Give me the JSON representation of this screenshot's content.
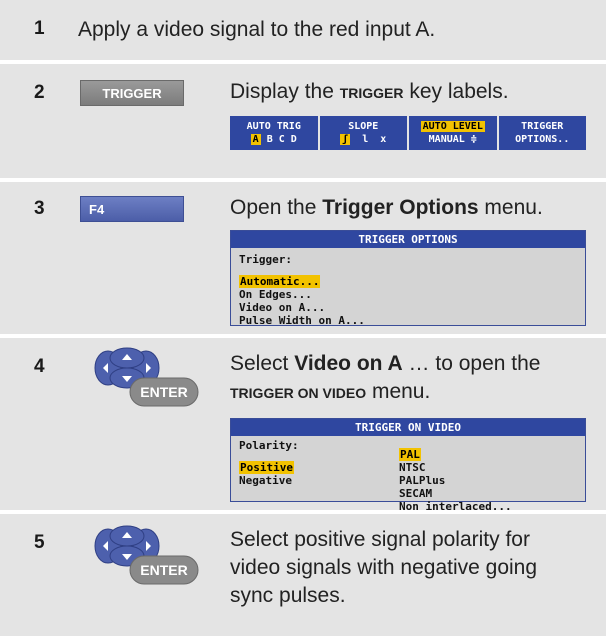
{
  "steps": [
    {
      "num": "1",
      "text": "Apply a video signal to the red input A."
    },
    {
      "num": "2",
      "text_before": "Display the ",
      "text_key": "TRIGGER",
      "text_after": " key labels.",
      "key": "TRIGGER"
    },
    {
      "num": "3",
      "text_before": "Open the ",
      "text_bold": "Trigger Options",
      "text_after": " menu.",
      "key": "F4"
    },
    {
      "num": "4",
      "text_before": "Select ",
      "text_bold": "Video on A",
      "text_middle": " … to open the ",
      "text_key": "TRIGGER ON VIDEO",
      "text_after": " menu.",
      "key": "ENTER"
    },
    {
      "num": "5",
      "line1": "Select positive signal polarity for",
      "line2": "video signals with negative going",
      "line3": "sync pulses.",
      "key": "ENTER"
    }
  ],
  "softkeys": [
    {
      "top": "AUTO TRIG",
      "bottom": "A B C D"
    },
    {
      "top": "SLOPE",
      "bottom": "ʃ  l  x"
    },
    {
      "top": "AUTO LEVEL",
      "bottom": "MANUAL ≑"
    },
    {
      "top": "TRIGGER",
      "bottom": "OPTIONS.."
    }
  ],
  "trigger_options_menu": {
    "title": "TRIGGER OPTIONS",
    "label": "Trigger:",
    "items": [
      "Automatic...",
      "On Edges...",
      "Video on A...",
      "Pulse Width on A..."
    ]
  },
  "trigger_on_video_menu": {
    "title": "TRIGGER ON VIDEO",
    "polarity_label": "Polarity:",
    "polarity": [
      "Positive",
      "Negative"
    ],
    "systems": [
      "PAL",
      "NTSC",
      "PALPlus",
      "SECAM",
      "Non interlaced..."
    ]
  },
  "colors": {
    "softkey_blue": "#2f47a0",
    "highlight": "#f2c200",
    "f4_key": "#5567b3"
  }
}
